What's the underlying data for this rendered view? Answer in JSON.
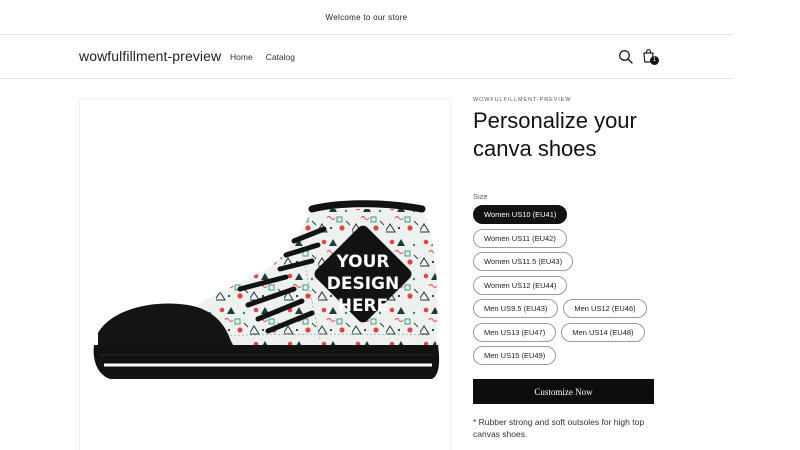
{
  "announcement": {
    "text": "Welcome to our store"
  },
  "header": {
    "logo": "wowfulfillment-preview",
    "nav": [
      {
        "label": "Home"
      },
      {
        "label": "Catalog"
      }
    ],
    "cart_count": "1",
    "icons": {
      "search": "search-icon",
      "cart": "cart-icon"
    }
  },
  "product": {
    "image_text": [
      "YOUR",
      "DESIGN",
      "HERE"
    ],
    "vendor": "WOWFULFILLMENT-PREVIEW",
    "title_line1": "Personalize your",
    "title_line2": "canva shoes",
    "size_label": "Size",
    "sizes": [
      {
        "label": "Women US10 (EU41)",
        "selected": true
      },
      {
        "label": "Women US11 (EU42)",
        "selected": false
      },
      {
        "label": "Women US11.5 (EU43)",
        "selected": false
      },
      {
        "label": "Women US12 (EU44)",
        "selected": false
      },
      {
        "label": "Men US9.5 (EU43)",
        "selected": false
      },
      {
        "label": "Men US12 (EU46)",
        "selected": false
      },
      {
        "label": "Men US13 (EU47)",
        "selected": false
      },
      {
        "label": "Men US14 (EU48)",
        "selected": false
      },
      {
        "label": "Men US15 (EU49)",
        "selected": false
      }
    ],
    "customize_label": "Customize Now",
    "description": "* Rubber strong and soft outsoles for high top canvas shoes."
  },
  "colors": {
    "text": "#121212",
    "button": "#0d0d0d",
    "border": "#9b9b9b"
  }
}
